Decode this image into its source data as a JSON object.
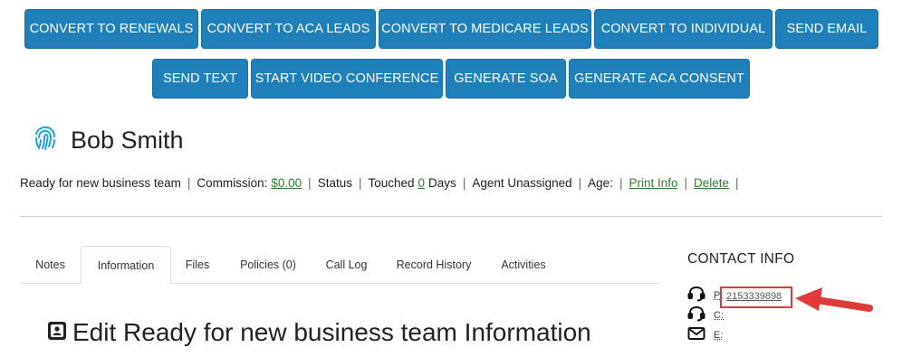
{
  "toolbar": {
    "row1": [
      "CONVERT TO RENEWALS",
      "CONVERT TO ACA LEADS",
      "CONVERT TO MEDICARE LEADS",
      "CONVERT TO INDIVIDUAL",
      "SEND EMAIL"
    ],
    "row2": [
      "SEND TEXT",
      "START VIDEO CONFERENCE",
      "GENERATE SOA",
      "GENERATE ACA CONSENT"
    ]
  },
  "contact": {
    "name": "Bob Smith",
    "icon": "fingerprint-icon"
  },
  "info_bar": {
    "team": "Ready for new business team",
    "commission_label": "Commission:",
    "commission_value": "$0.00",
    "status_label": "Status",
    "touched_label": "Touched",
    "touched_value": "0",
    "touched_unit": "Days",
    "agent": "Agent Unassigned",
    "age_label": "Age:",
    "print_info": "Print Info",
    "delete": "Delete"
  },
  "tabs": [
    {
      "label": "Notes",
      "active": false
    },
    {
      "label": "Information",
      "active": true
    },
    {
      "label": "Files",
      "active": false
    },
    {
      "label": "Policies (0)",
      "active": false
    },
    {
      "label": "Call Log",
      "active": false
    },
    {
      "label": "Record History",
      "active": false
    },
    {
      "label": "Activities",
      "active": false
    }
  ],
  "edit_section": {
    "title": "Edit Ready for new business team Information",
    "icon": "contact-card-icon"
  },
  "contact_info": {
    "title": "CONTACT INFO",
    "phone_label": "P:",
    "phone_value": "2153339898",
    "cell_label": "C:",
    "email_label": "E:"
  },
  "colors": {
    "button_bg": "#1f7fb8",
    "link": "#2e7d32",
    "highlight": "#e03b3b",
    "fingerprint": "#1aa3dc"
  }
}
